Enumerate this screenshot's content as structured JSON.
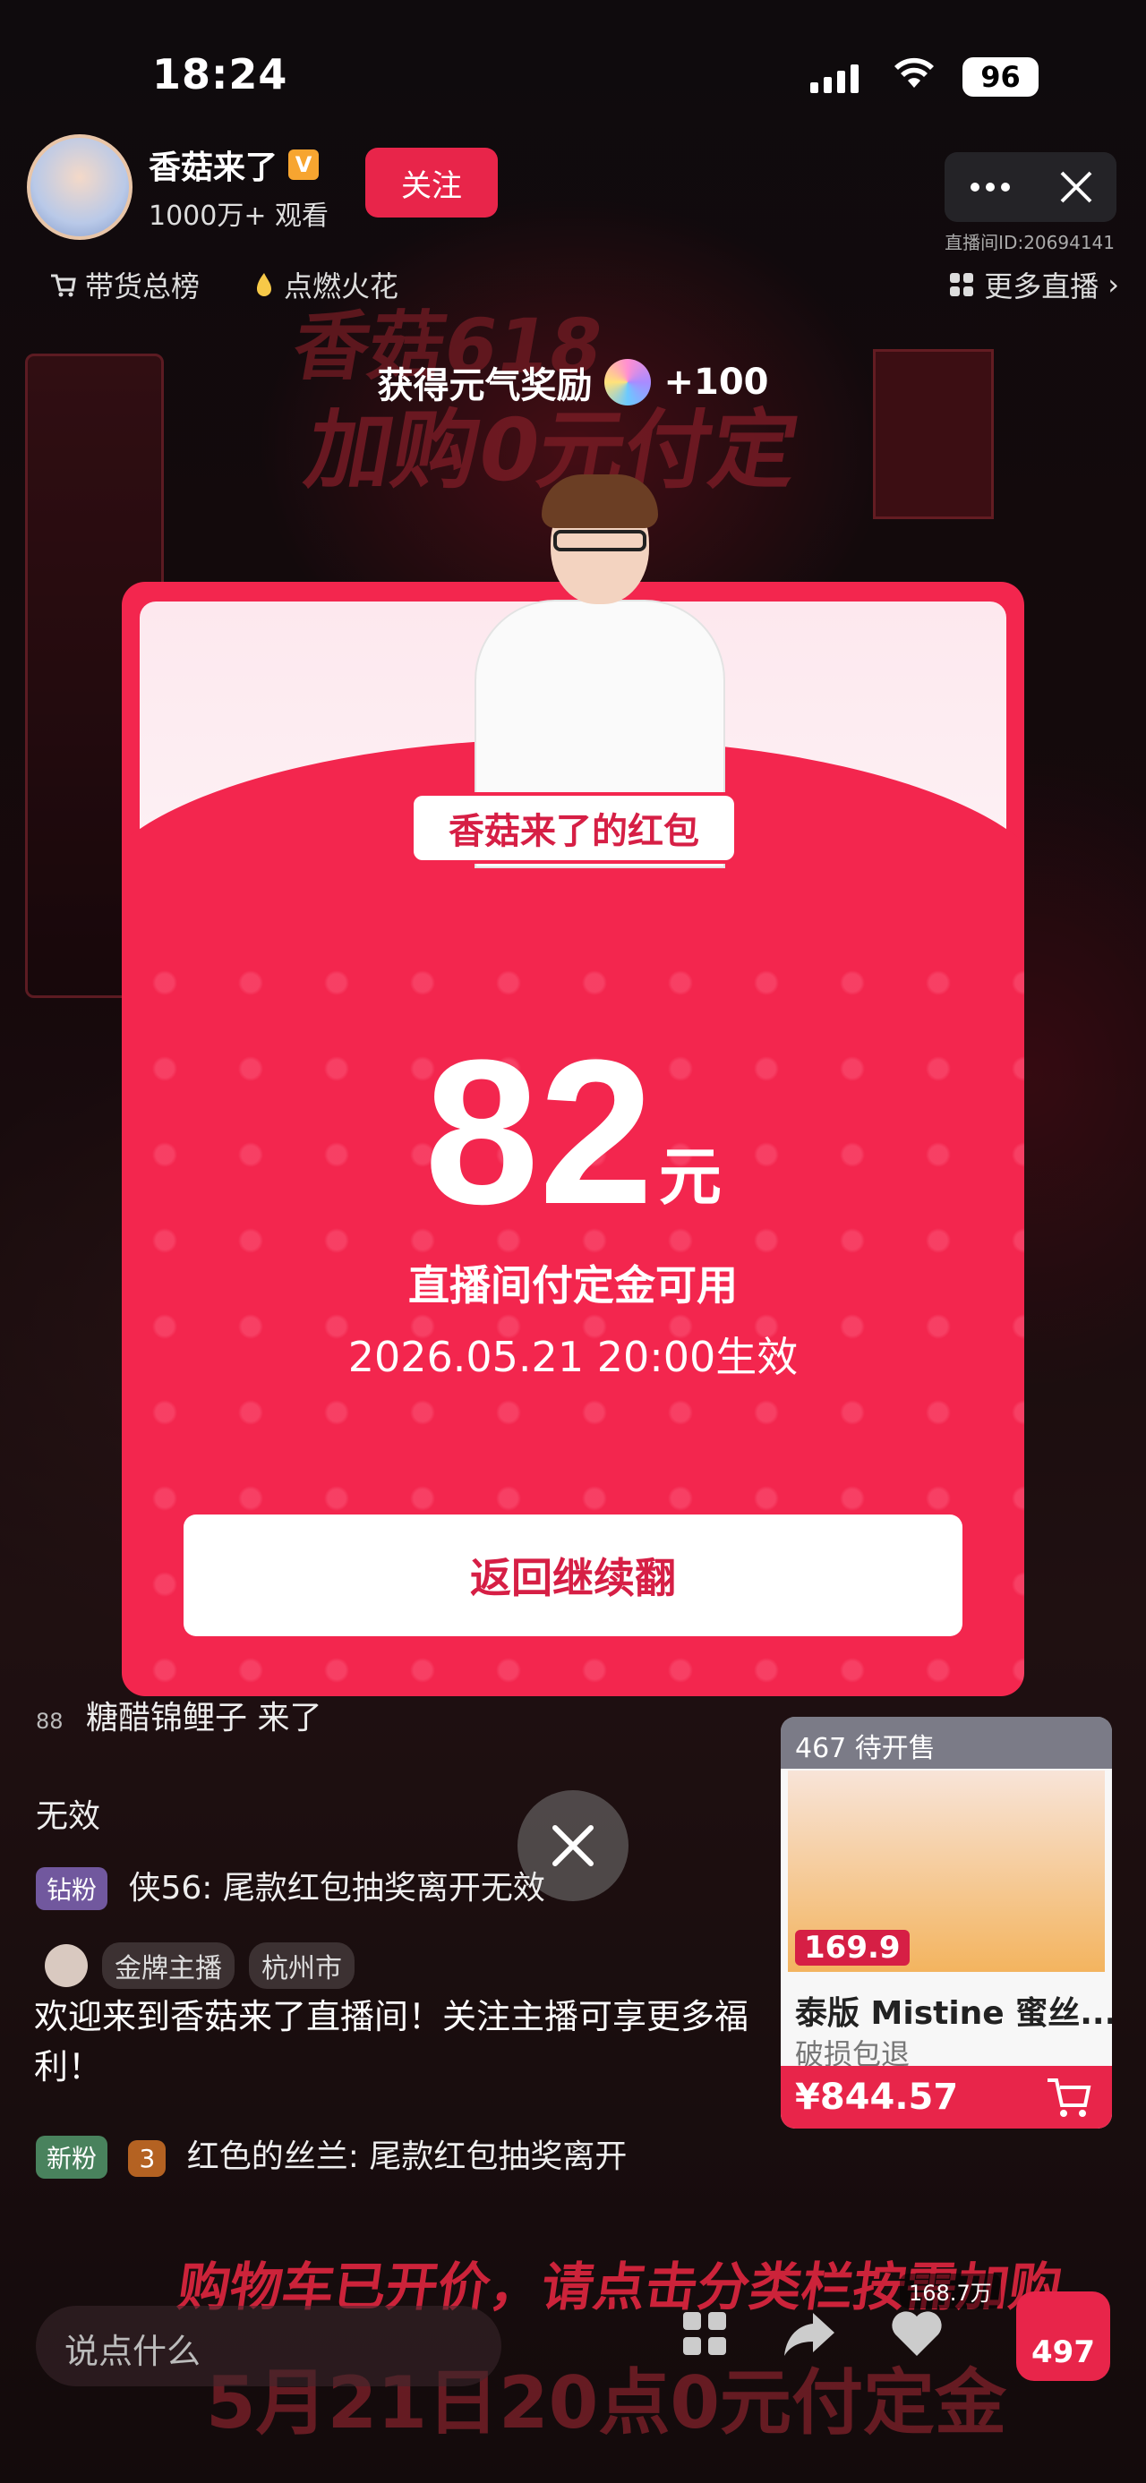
{
  "status_bar": {
    "time": "18:24",
    "battery": "96"
  },
  "host": {
    "name": "香菇来了",
    "verified_mark": "V",
    "views": "1000万+ 观看",
    "follow_label": "关注",
    "room_id": "直播间ID:20694141"
  },
  "subnav": {
    "left1": "带货总榜",
    "left2": "点燃火花",
    "right": "更多直播"
  },
  "background": {
    "poster_title_line1": "香菇618",
    "poster_title_line2": "加购0元付定"
  },
  "reward_toast": {
    "text": "获得元气奖励",
    "amount": "+100"
  },
  "red_packet": {
    "label": "香菇来了的红包",
    "amount": "82",
    "unit": "元",
    "use_note": "直播间付定金可用",
    "valid_from": "2026.05.21 20:00生效",
    "return_button": "返回继续翻"
  },
  "chat": {
    "lines": [
      {
        "prefix": "88",
        "text": "糖醋锦鲤子  来了"
      },
      {
        "text": "无效"
      },
      {
        "badge": "钻粉",
        "text": "侠56: 尾款红包抽奖离开无效"
      },
      {
        "badge": "新粉",
        "level": "3",
        "text": "红色的丝兰: 尾款红包抽奖离开"
      }
    ],
    "host_tag1": "金牌主播",
    "host_tag2": "杭州市",
    "welcome": "欢迎来到香菇来了直播间！关注主播可享更多福利！"
  },
  "product": {
    "pre_sale": "467 待开售",
    "price_tag": "169.9",
    "name": "泰版 Mistine 蜜丝...",
    "sub": "破损包退",
    "price": "¥844.57"
  },
  "bottom": {
    "banner": "购物车已开价，请点击分类栏按需加购",
    "banner2": "5月21日20点0元付定金",
    "say_placeholder": "说点什么",
    "likes": "168.7万",
    "cart_count": "497"
  },
  "colors": {
    "accent_red": "#f3264e",
    "follow_red": "#e8254a"
  }
}
